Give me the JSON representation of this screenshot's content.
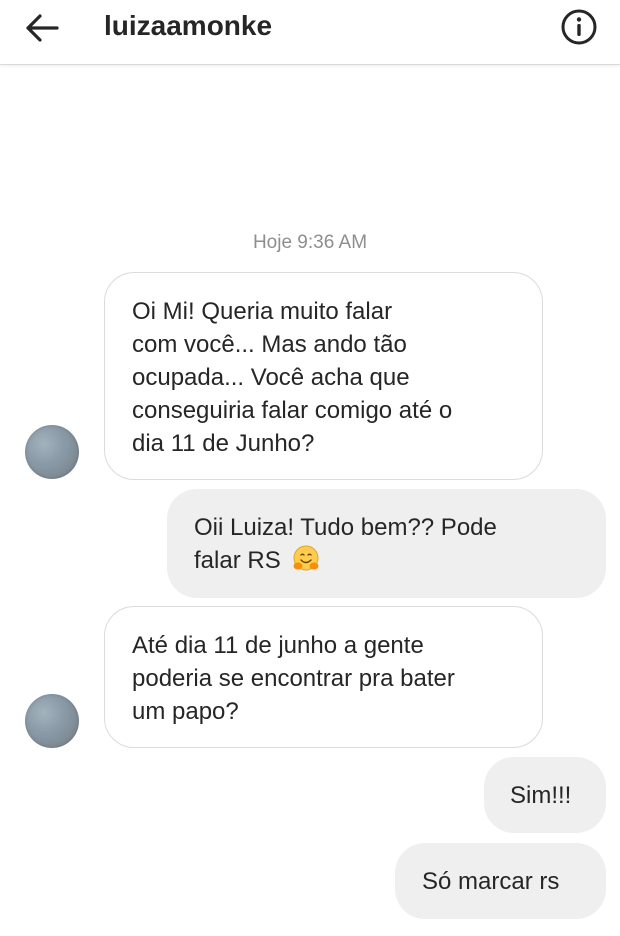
{
  "header": {
    "title": "luizaamonke",
    "back_icon": "arrow-left-icon",
    "info_icon": "info-circle-icon"
  },
  "timestamp": "Hoje 9:36 AM",
  "messages": [
    {
      "from": "them",
      "lines": [
        "Oi Mi! Queria muito falar",
        "com você... Mas ando tão",
        "ocupada... Você acha que",
        "conseguiria falar comigo até o",
        "dia 11 de Junho?"
      ]
    },
    {
      "from": "me",
      "lines": [
        "Oii Luiza! Tudo bem?? Pode",
        "falar RS"
      ],
      "emoji": "hugging-face-emoji"
    },
    {
      "from": "them",
      "lines": [
        "Até dia 11 de junho a gente",
        "poderia se encontrar pra bater",
        "um papo?"
      ]
    },
    {
      "from": "me",
      "lines": [
        "Sim!!!"
      ]
    },
    {
      "from": "me",
      "lines": [
        "Só marcar rs"
      ]
    }
  ],
  "colors": {
    "received_bubble_border": "#dbdbdb",
    "sent_bubble_bg": "#efefef",
    "text": "#262626",
    "timestamp": "#8e8e8e"
  }
}
